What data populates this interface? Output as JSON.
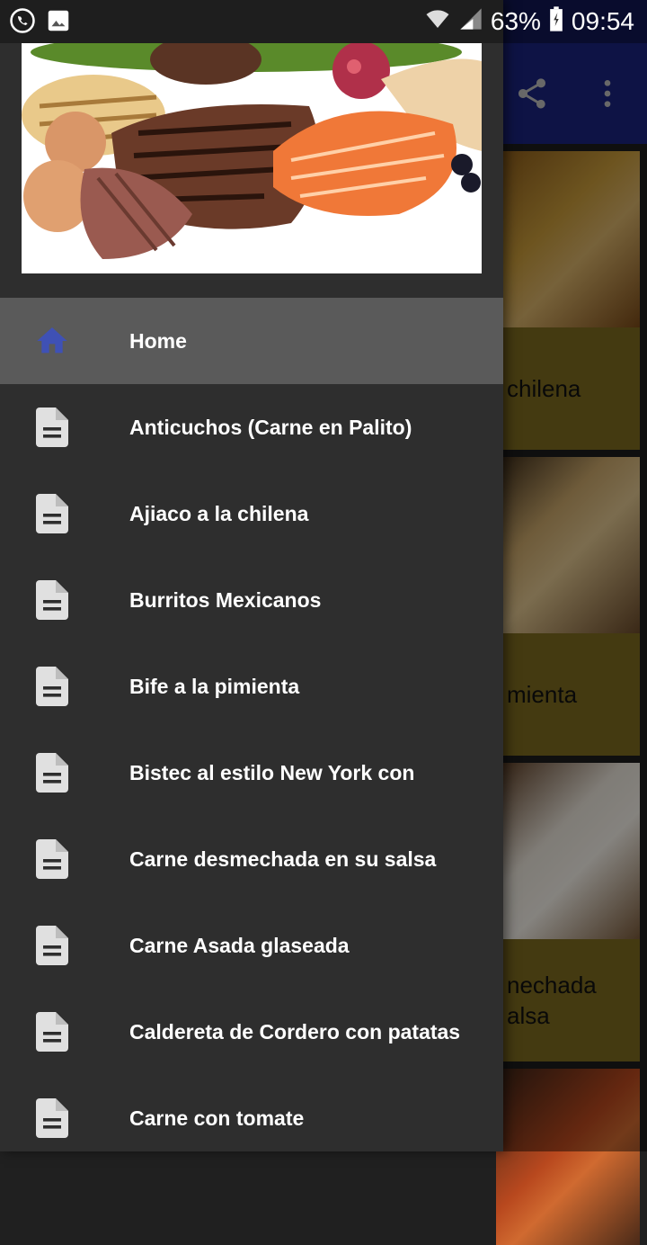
{
  "status_bar": {
    "battery": "63%",
    "time": "09:54",
    "icons": [
      "whatsapp-icon",
      "image-icon",
      "wifi-icon",
      "signal-icon",
      "battery-icon"
    ]
  },
  "app_bar": {
    "actions": [
      "share-icon",
      "more-vert-icon"
    ]
  },
  "background_cards": [
    {
      "title": "chilena"
    },
    {
      "title": "mienta"
    },
    {
      "title_line1": "nechada",
      "title_line2": "alsa"
    }
  ],
  "drawer": {
    "header_image": "meat-and-fish-banner",
    "menu_items": [
      {
        "label": "Home",
        "icon": "home-icon",
        "active": true
      },
      {
        "label": "Anticuchos (Carne en Palito)",
        "icon": "document-icon"
      },
      {
        "label": "Ajiaco a la chilena",
        "icon": "document-icon"
      },
      {
        "label": "Burritos Mexicanos",
        "icon": "document-icon"
      },
      {
        "label": "Bife a la pimienta",
        "icon": "document-icon"
      },
      {
        "label": "Bistec al estilo New York con",
        "icon": "document-icon"
      },
      {
        "label": "Carne desmechada en su salsa",
        "icon": "document-icon"
      },
      {
        "label": "Carne Asada glaseada",
        "icon": "document-icon"
      },
      {
        "label": "Caldereta de Cordero con patatas",
        "icon": "document-icon"
      },
      {
        "label": "Carne con tomate",
        "icon": "document-icon"
      }
    ]
  },
  "colors": {
    "primary": "#1a237e",
    "drawer_bg": "#2e2e2e",
    "active_item_bg": "#5a5a5a",
    "home_icon": "#3f51b5",
    "doc_icon": "#e0e0e0",
    "card_band": "#7d6a1f"
  }
}
